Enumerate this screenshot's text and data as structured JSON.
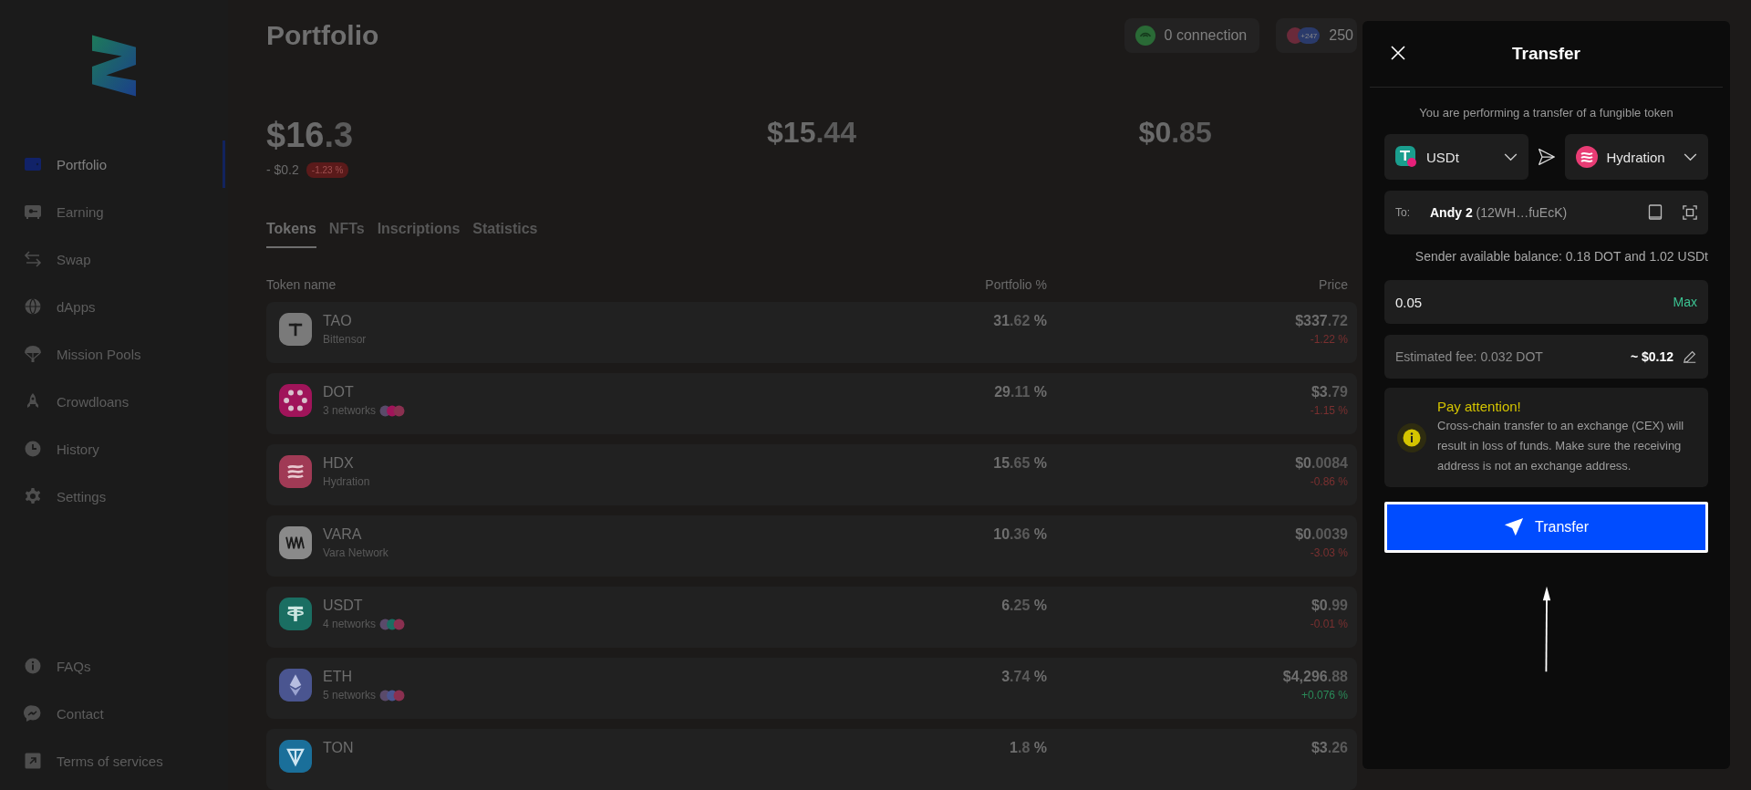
{
  "sidebar": {
    "items": [
      {
        "label": "Portfolio",
        "kind": "wallet",
        "selected": true
      },
      {
        "label": "Earning",
        "kind": "safe",
        "selected": false
      },
      {
        "label": "Swap",
        "kind": "swap",
        "selected": false
      },
      {
        "label": "dApps",
        "kind": "globe",
        "selected": false
      },
      {
        "label": "Mission Pools",
        "kind": "parachute",
        "selected": false
      },
      {
        "label": "Crowdloans",
        "kind": "rocket",
        "selected": false
      },
      {
        "label": "History",
        "kind": "clock",
        "selected": false
      },
      {
        "label": "Settings",
        "kind": "gear",
        "selected": false
      }
    ],
    "footer_items": [
      {
        "label": "FAQs",
        "kind": "info"
      },
      {
        "label": "Contact",
        "kind": "chat"
      },
      {
        "label": "Terms of services",
        "kind": "external"
      }
    ]
  },
  "header": {
    "title": "Portfolio",
    "connection": "0 connection",
    "accounts_badge": "+247",
    "accounts_count": "250"
  },
  "balances": [
    {
      "amount": "$16.3",
      "change": "- $0.2",
      "change_percent": "-1.23 %",
      "negative": true
    },
    {
      "amount": "$15.44"
    },
    {
      "amount": "$0.85"
    }
  ],
  "tabs": [
    {
      "label": "Tokens",
      "selected": true
    },
    {
      "label": "NFTs",
      "selected": false
    },
    {
      "label": "Inscriptions",
      "selected": false
    },
    {
      "label": "Statistics",
      "selected": false
    }
  ],
  "table": {
    "columns": [
      "Token name",
      "Portfolio %",
      "Price"
    ],
    "rows": [
      {
        "symbol": "TAO",
        "subtitle": "Bittensor",
        "networks": false,
        "kind": "tao",
        "color": "#7a7a7a",
        "portfolio": "31.62 %",
        "price": "$337.72",
        "change": "-1.22 %",
        "negative": true
      },
      {
        "symbol": "DOT",
        "subtitle": "3 networks",
        "networks": true,
        "kind": "dot",
        "color": "#a0145a",
        "portfolio": "29.11 %",
        "price": "$3.79",
        "change": "-1.15 %",
        "negative": true
      },
      {
        "symbol": "HDX",
        "subtitle": "Hydration",
        "networks": false,
        "kind": "hdx",
        "color": "#a03a55",
        "portfolio": "15.65 %",
        "price": "$0.0084",
        "change": "-0.86 %",
        "negative": true
      },
      {
        "symbol": "VARA",
        "subtitle": "Vara Network",
        "networks": false,
        "kind": "vara",
        "color": "#8a8a8a",
        "portfolio": "10.36 %",
        "price": "$0.0039",
        "change": "-3.03 %",
        "negative": true
      },
      {
        "symbol": "USDT",
        "subtitle": "4 networks",
        "networks": true,
        "kind": "usdt",
        "color": "#1a6e62",
        "portfolio": "6.25 %",
        "price": "$0.99",
        "change": "-0.01 %",
        "negative": true
      },
      {
        "symbol": "ETH",
        "subtitle": "5 networks",
        "networks": true,
        "kind": "eth",
        "color": "#4a5590",
        "portfolio": "3.74 %",
        "price": "$4,296.88",
        "change": "+0.076 %",
        "negative": false
      },
      {
        "symbol": "TON",
        "kind": "ton",
        "color": "#1a6f9a",
        "portfolio": "1.8 %",
        "price": "$3.26"
      }
    ]
  },
  "transfer": {
    "title": "Transfer",
    "subtitle": "You are performing a transfer of a fungible token",
    "token": "USDt",
    "destination": "Hydration",
    "to_label": "To:",
    "recipient_name": "Andy 2",
    "recipient_address": "(12WH…fuEcK)",
    "balance_note": "Sender available balance: 0.18 DOT and 1.02 USDt",
    "amount": "0.05",
    "max": "Max",
    "fee_label": "Estimated fee: 0.032 DOT",
    "fee_value": "~ $0.12",
    "warning_title": "Pay attention!",
    "warning_text": "Cross-chain transfer to an exchange (CEX) will result in loss of funds. Make sure the receiving address is not an exchange address.",
    "button": "Transfer"
  }
}
